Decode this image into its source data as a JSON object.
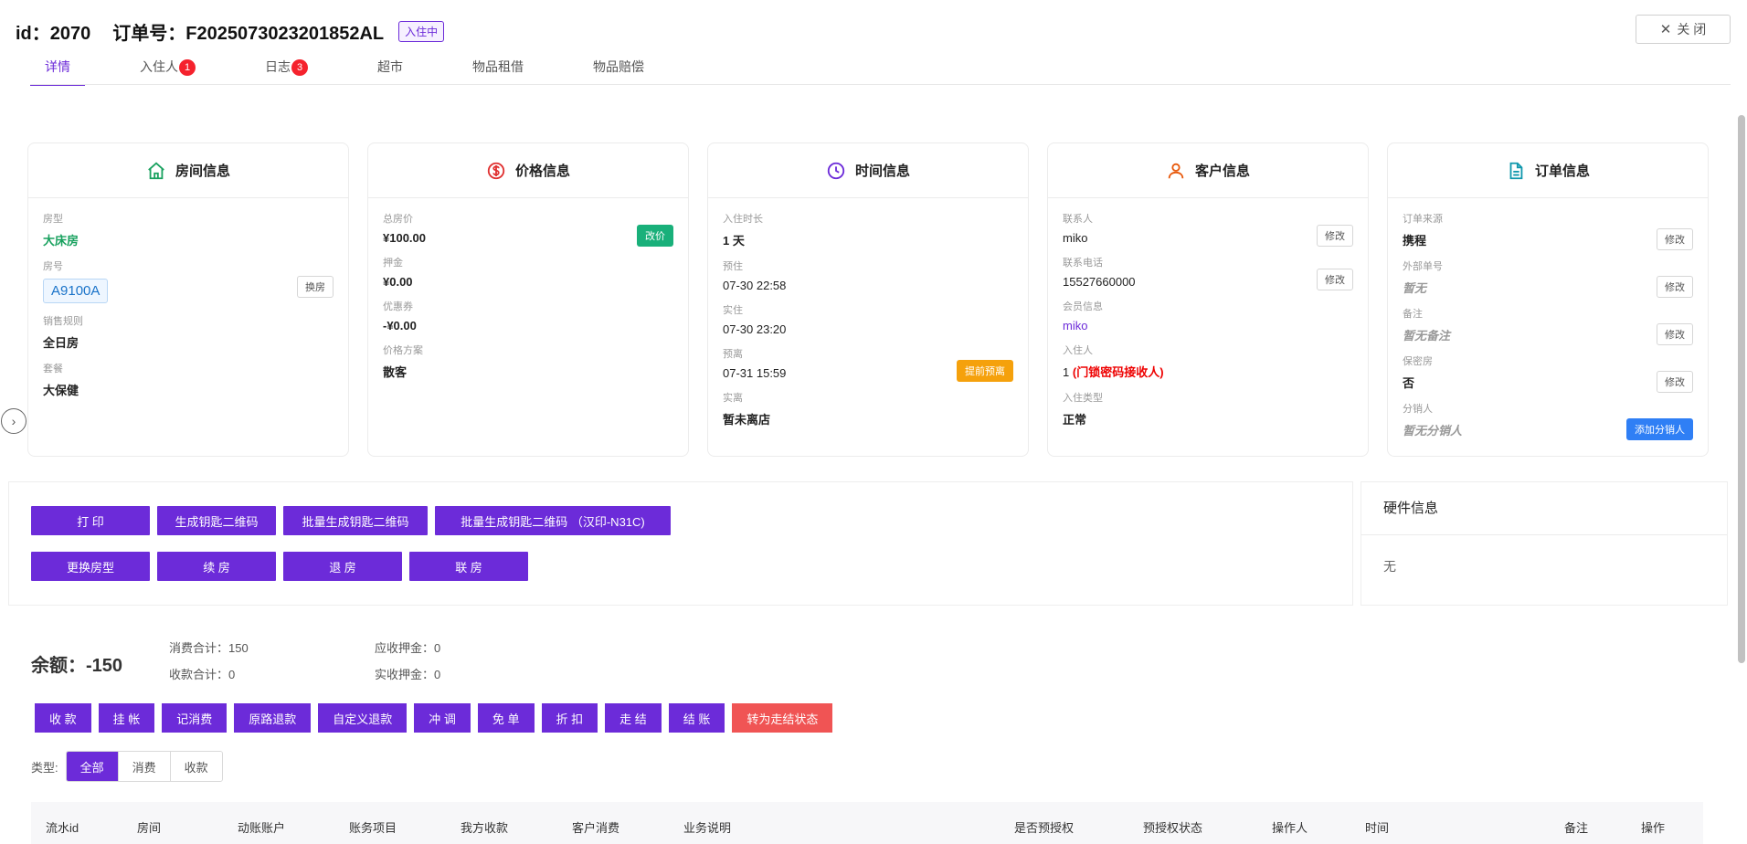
{
  "header": {
    "id_text": "id：2070",
    "order_text": "订单号：F2025073023201852AL",
    "status": "入住中",
    "close_label": "关 闭"
  },
  "tabs": [
    {
      "label": "详情",
      "badge": ""
    },
    {
      "label": "入住人",
      "badge": "1"
    },
    {
      "label": "日志",
      "badge": "3"
    },
    {
      "label": "超市",
      "badge": ""
    },
    {
      "label": "物品租借",
      "badge": ""
    },
    {
      "label": "物品赔偿",
      "badge": ""
    }
  ],
  "room": {
    "title": "房间信息",
    "type_label": "房型",
    "type_value": "大床房",
    "no_label": "房号",
    "no_value": "A9100A",
    "change_btn": "换房",
    "rule_label": "销售规则",
    "rule_value": "全日房",
    "pkg_label": "套餐",
    "pkg_value": "大保健"
  },
  "price": {
    "title": "价格信息",
    "total_label": "总房价",
    "total_value": "¥100.00",
    "edit_btn": "改价",
    "deposit_label": "押金",
    "deposit_value": "¥0.00",
    "coupon_label": "优惠券",
    "coupon_value": "-¥0.00",
    "plan_label": "价格方案",
    "plan_value": "散客"
  },
  "time": {
    "title": "时间信息",
    "duration_label": "入住时长",
    "duration_value": "1 天",
    "pre_in_label": "预住",
    "pre_in_value": "07-30 22:58",
    "real_in_label": "实住",
    "real_in_value": "07-30 23:20",
    "pre_out_label": "预离",
    "pre_out_value": "07-31 15:59",
    "early_btn": "提前预离",
    "real_out_label": "实离",
    "real_out_value": "暂未离店"
  },
  "customer": {
    "title": "客户信息",
    "contact_label": "联系人",
    "contact_value": "miko",
    "edit_btn": "修改",
    "phone_label": "联系电话",
    "phone_value": "15527660000",
    "member_label": "会员信息",
    "member_value": "miko",
    "guest_label": "入住人",
    "guest_count": "1",
    "guest_note": "(门锁密码接收人)",
    "ctype_label": "入住类型",
    "ctype_value": "正常"
  },
  "order": {
    "title": "订单信息",
    "source_label": "订单来源",
    "source_value": "携程",
    "edit_btn": "修改",
    "ext_label": "外部单号",
    "ext_value": "暂无",
    "remark_label": "备注",
    "remark_value": "暂无备注",
    "secret_label": "保密房",
    "secret_value": "否",
    "seller_label": "分销人",
    "seller_value": "暂无分销人",
    "add_seller_btn": "添加分销人"
  },
  "actions": {
    "row1": [
      "打 印",
      "生成钥匙二维码",
      "批量生成钥匙二维码",
      "批量生成钥匙二维码 （汉印-N31C)"
    ],
    "row2": [
      "更换房型",
      "续 房",
      "退 房",
      "联 房"
    ]
  },
  "hardware": {
    "title": "硬件信息",
    "value": "无"
  },
  "bill": {
    "balance": "余额：-150",
    "consume_total": "消费合计：150",
    "receive_total": "收款合计：0",
    "deposit_due": "应收押金：0",
    "deposit_real": "实收押金：0",
    "buttons": [
      "收 款",
      "挂 帐",
      "记消费",
      "原路退款",
      "自定义退款",
      "冲 调",
      "免 单",
      "折 扣",
      "走 结",
      "结 账"
    ],
    "red_button": "转为走结状态",
    "type_label": "类型:",
    "types": [
      "全部",
      "消费",
      "收款"
    ],
    "columns": [
      "流水id",
      "房间",
      "动账账户",
      "账务项目",
      "我方收款",
      "客户消费",
      "业务说明",
      "是否预授权",
      "预授权状态",
      "操作人",
      "时间",
      "备注",
      "操作"
    ]
  },
  "colors": {
    "accent": "#6c2bd9",
    "green": "#19a15f",
    "danger": "#f05454"
  }
}
